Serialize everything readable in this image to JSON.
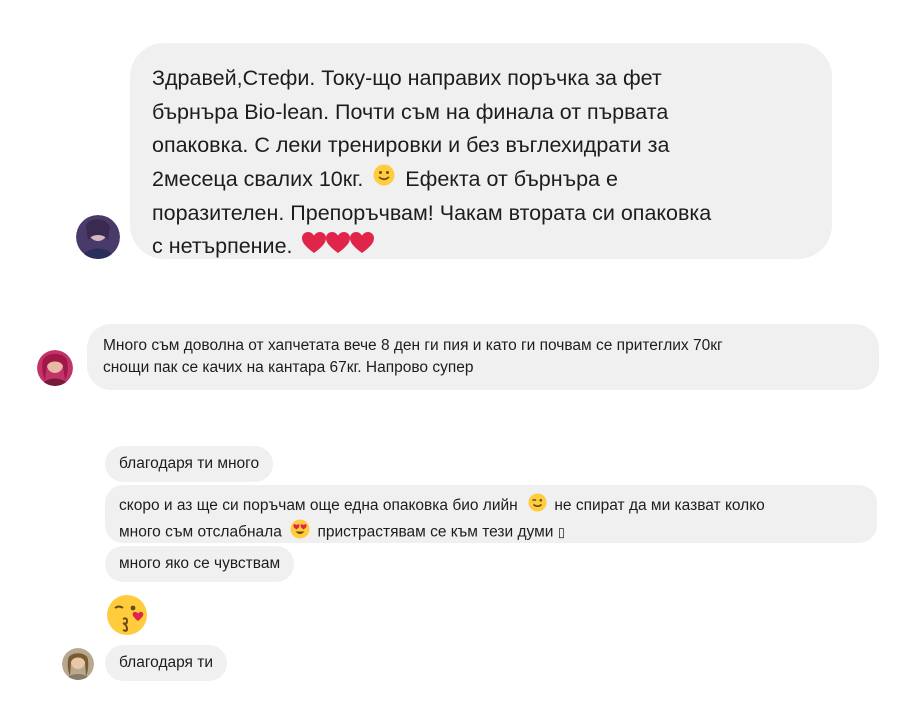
{
  "messages": [
    {
      "lines": [
        "Здравей,Стефи. Току-що направих поръчка за фет",
        "бърнъра Bio-lean. Почти съм на финала от първата",
        "опаковка. С леки тренировки и без въглехидрати за",
        "2месеца свалих 10кг.",
        "Ефекта от бърнъра е",
        "поразителен. Препоръчвам! Чакам втората си опаковка",
        "с нетърпение."
      ]
    },
    {
      "lines": [
        "Много съм доволна от хапчетата вече 8 ден ги пия и като ги почвам се притеглих 70кг",
        "снощи пак се качих на кантара 67кг. Напрово супер"
      ]
    },
    {
      "text": "благодаря ти много"
    },
    {
      "line1a": "скоро и аз ще си поръчам още една опаковка био лийн",
      "line1b": "не спират да ми казват колко",
      "line2a": "много съм отслабнала",
      "line2b": "пристрастявам се към тези думи",
      "glyph": "▯"
    },
    {
      "text": "много яко се чувствам"
    },
    {
      "text": "благодаря ти"
    }
  ],
  "icons": {
    "smile": "slightly-smiling-face-icon",
    "heart": "red-heart-icon",
    "wink": "winking-face-icon",
    "heart_eyes": "heart-eyes-face-icon",
    "kiss": "face-blowing-kiss-icon"
  },
  "colors": {
    "bubble": "#f1f0f0",
    "text": "#1d1d1d",
    "emoji_yellow": "#ffcc3e",
    "heart_red": "#e0244a"
  }
}
